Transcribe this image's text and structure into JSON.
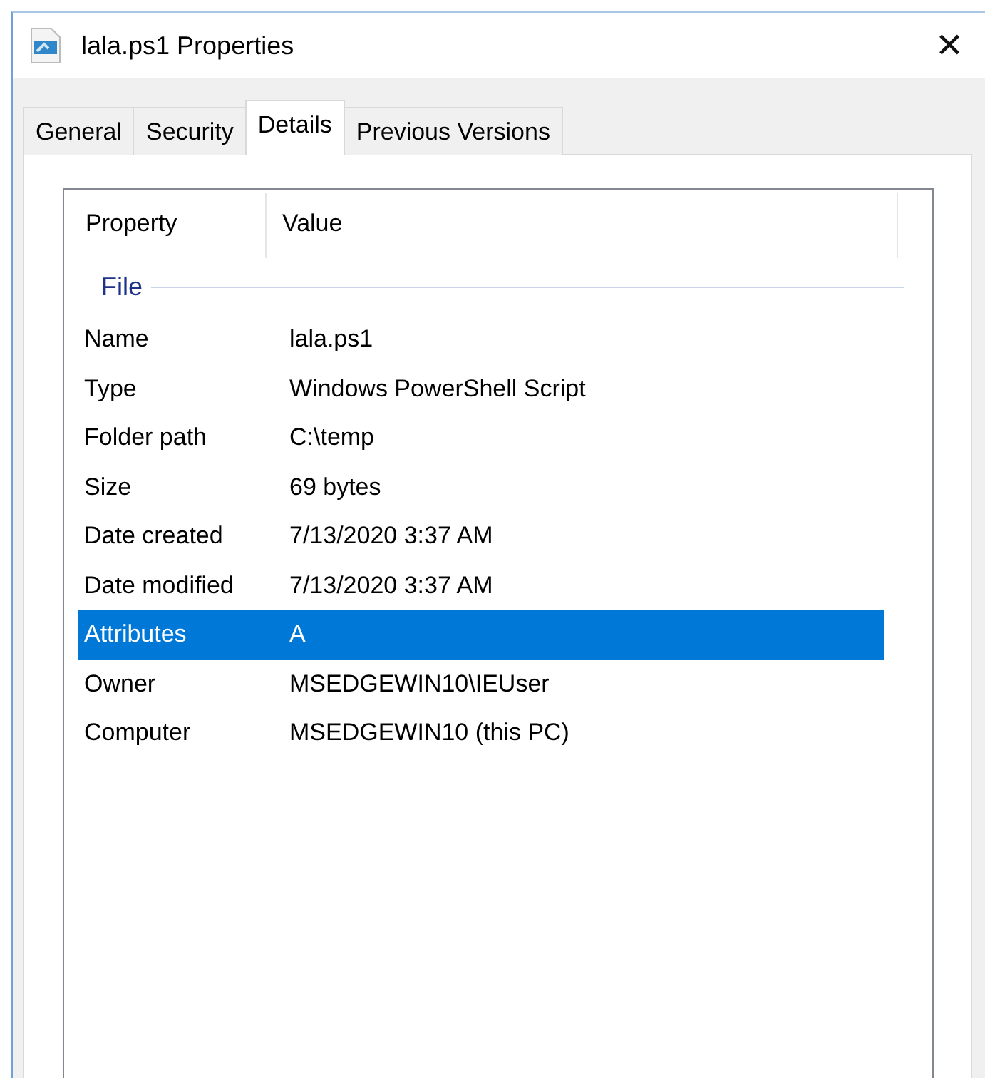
{
  "window": {
    "title": "lala.ps1 Properties",
    "close": "✕"
  },
  "tabs": [
    {
      "label": "General",
      "selected": false
    },
    {
      "label": "Security",
      "selected": false
    },
    {
      "label": "Details",
      "selected": true
    },
    {
      "label": "Previous Versions",
      "selected": false
    }
  ],
  "table": {
    "columns": [
      "Property",
      "Value"
    ],
    "group": "File",
    "rows": [
      {
        "property": "Name",
        "value": "lala.ps1",
        "selected": false
      },
      {
        "property": "Type",
        "value": "Windows PowerShell Script",
        "selected": false
      },
      {
        "property": "Folder path",
        "value": "C:\\temp",
        "selected": false
      },
      {
        "property": "Size",
        "value": "69 bytes",
        "selected": false
      },
      {
        "property": "Date created",
        "value": "7/13/2020 3:37 AM",
        "selected": false
      },
      {
        "property": "Date modified",
        "value": "7/13/2020 3:37 AM",
        "selected": false
      },
      {
        "property": "Attributes",
        "value": "A",
        "selected": true
      },
      {
        "property": "Owner",
        "value": "MSEDGEWIN10\\IEUser",
        "selected": false
      },
      {
        "property": "Computer",
        "value": "MSEDGEWIN10 (this PC)",
        "selected": false
      }
    ]
  }
}
